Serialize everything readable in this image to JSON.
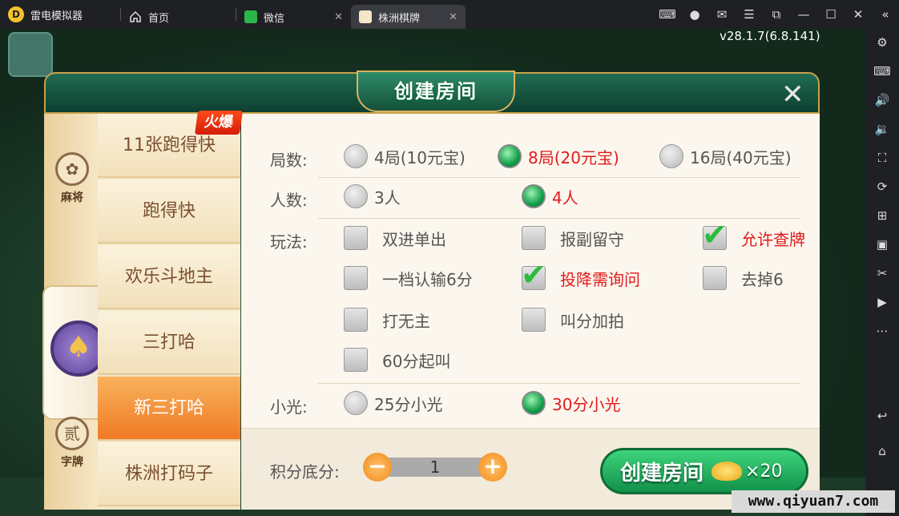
{
  "emulator": {
    "app_name": "雷电模拟器",
    "tabs": [
      {
        "label": "首页"
      },
      {
        "label": "微信"
      },
      {
        "label": "株洲棋牌"
      }
    ]
  },
  "game": {
    "version": "v28.1.7(6.8.141)"
  },
  "dialog": {
    "title": "创建房间",
    "close": "✕",
    "categories": [
      {
        "label": "麻将",
        "icon": "mahjong-icon"
      },
      {
        "label": "",
        "icon": "spade-chip-icon"
      },
      {
        "label": "字牌",
        "icon": "character-tile-icon",
        "glyph": "贰"
      }
    ],
    "hot_badge": "火爆",
    "games": [
      "11张跑得快",
      "跑得快",
      "欢乐斗地主",
      "三打哈",
      "新三打哈",
      "株洲打码子"
    ],
    "selected_game": "新三打哈",
    "rounds": {
      "label": "局数:",
      "options": [
        "4局(10元宝)",
        "8局(20元宝)",
        "16局(40元宝)"
      ],
      "selected": 1
    },
    "players": {
      "label": "人数:",
      "options": [
        "3人",
        "4人"
      ],
      "selected": 1
    },
    "rules": {
      "label": "玩法:",
      "items": [
        {
          "label": "双进单出",
          "checked": false
        },
        {
          "label": "报副留守",
          "checked": false
        },
        {
          "label": "允许查牌",
          "checked": true
        },
        {
          "label": "一档认输6分",
          "checked": false
        },
        {
          "label": "投降需询问",
          "checked": true
        },
        {
          "label": "去掉6",
          "checked": false
        },
        {
          "label": "打无主",
          "checked": false
        },
        {
          "label": "叫分加拍",
          "checked": false
        },
        {
          "label": "60分起叫",
          "checked": false
        }
      ]
    },
    "small_light": {
      "label": "小光:",
      "options": [
        "25分小光",
        "30分小光"
      ],
      "selected": 1
    },
    "score_base": {
      "label": "积分底分:",
      "value": "1",
      "minus": "−",
      "plus": "+"
    },
    "create_button": {
      "label": "创建房间",
      "cost": "×20"
    }
  },
  "watermark": "www.qiyuan7.com"
}
